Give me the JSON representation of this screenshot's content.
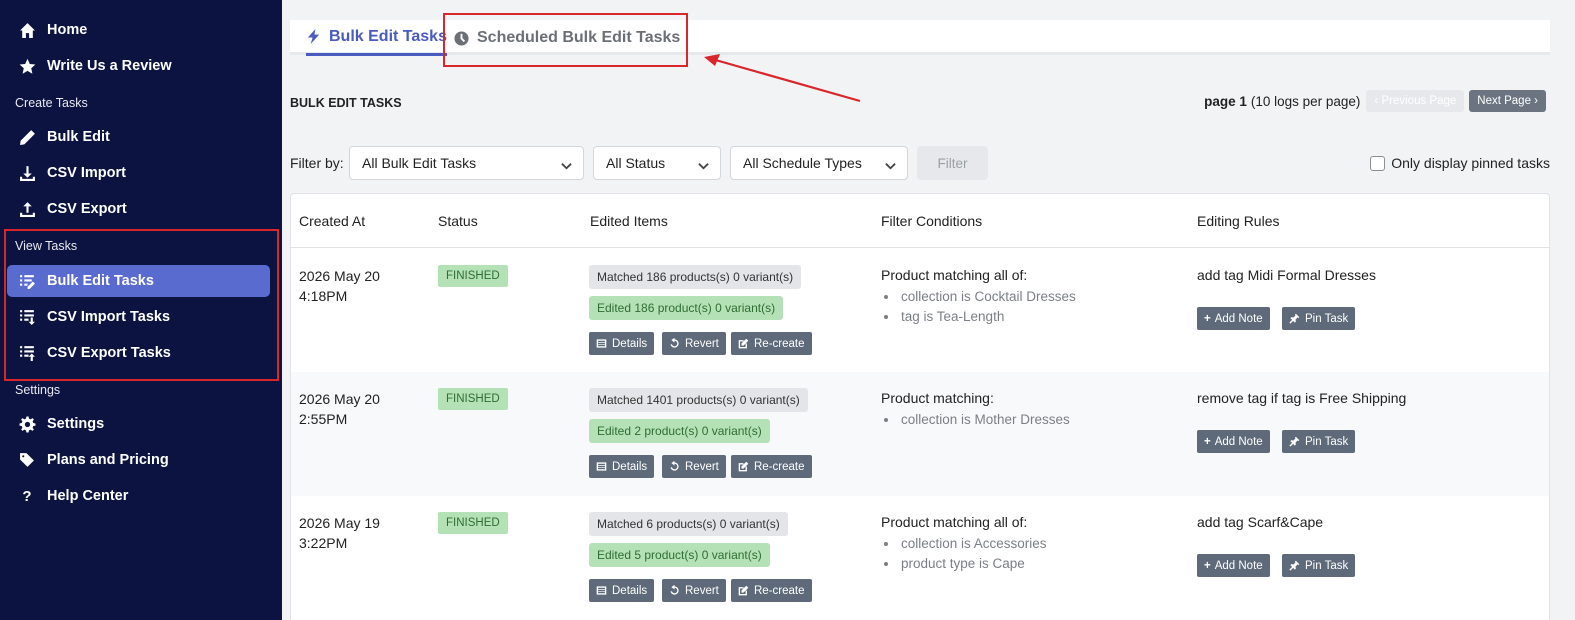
{
  "sidebar": {
    "items": [
      {
        "label": "Home",
        "icon": "home-icon"
      },
      {
        "label": "Write Us a Review",
        "icon": "star-icon"
      },
      {
        "label": "Bulk Edit",
        "icon": "pencil-icon"
      },
      {
        "label": "CSV Import",
        "icon": "download-icon"
      },
      {
        "label": "CSV Export",
        "icon": "upload-icon"
      },
      {
        "label": "Bulk Edit Tasks",
        "icon": "list-edit-icon"
      },
      {
        "label": "CSV Import Tasks",
        "icon": "list-import-icon"
      },
      {
        "label": "CSV Export Tasks",
        "icon": "list-export-icon"
      },
      {
        "label": "Settings",
        "icon": "gear-icon"
      },
      {
        "label": "Plans and Pricing",
        "icon": "tags-icon"
      },
      {
        "label": "Help Center",
        "icon": "question-icon"
      }
    ],
    "sections": {
      "create": "Create Tasks",
      "view": "View Tasks",
      "settings": "Settings"
    },
    "active_color": "#5a6bd0",
    "bg_color": "#0c1340"
  },
  "tabs": {
    "bulk": "Bulk Edit Tasks",
    "scheduled": "Scheduled Bulk Edit Tasks"
  },
  "heading": "BULK EDIT TASKS",
  "pager": {
    "page": "page 1",
    "sub": "(10 logs per page)",
    "prev": "Previous Page",
    "next": "Next Page"
  },
  "filters": {
    "label": "Filter by:",
    "tasks": "All Bulk Edit Tasks",
    "status": "All Status",
    "schedule": "All Schedule Types",
    "button": "Filter",
    "pinned": "Only display pinned tasks"
  },
  "table": {
    "headers": [
      "Created At",
      "Status",
      "Edited Items",
      "Filter Conditions",
      "Editing Rules"
    ],
    "actions": {
      "details": "Details",
      "revert": "Revert",
      "recreate": "Re-create",
      "note": "Add Note",
      "pin": "Pin Task"
    },
    "rows": [
      {
        "date": "2026 May 20",
        "time": "4:18PM",
        "status": "FINISHED",
        "matched": "Matched 186 products(s) 0 variant(s)",
        "edited": "Edited 186 product(s) 0 variant(s)",
        "cond_title": "Product matching all of:",
        "conds": [
          "collection is Cocktail Dresses",
          "tag is Tea-Length"
        ],
        "rule": "add tag Midi Formal Dresses"
      },
      {
        "date": "2026 May 20",
        "time": "2:55PM",
        "status": "FINISHED",
        "matched": "Matched 1401 products(s) 0 variant(s)",
        "edited": "Edited 2 product(s) 0 variant(s)",
        "cond_title": "Product matching:",
        "conds": [
          "collection is Mother Dresses"
        ],
        "rule": "remove tag if tag is Free Shipping"
      },
      {
        "date": "2026 May 19",
        "time": "3:22PM",
        "status": "FINISHED",
        "matched": "Matched 6 products(s) 0 variant(s)",
        "edited": "Edited 5 product(s) 0 variant(s)",
        "cond_title": "Product matching all of:",
        "conds": [
          "collection is Accessories",
          "product type is Cape"
        ],
        "rule": "add tag Scarf&Cape"
      }
    ]
  },
  "colors": {
    "accent": "#4a5bc0",
    "annotation": "#d8262b",
    "finished": "#b4e2b6"
  }
}
